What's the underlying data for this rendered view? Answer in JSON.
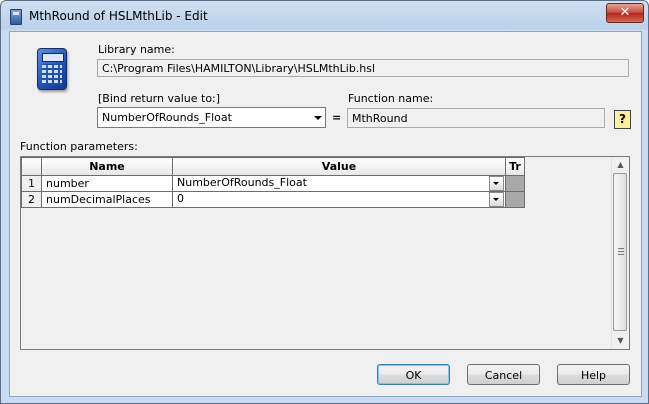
{
  "window": {
    "title": "MthRound of HSLMthLib - Edit",
    "close_glyph": "✕"
  },
  "library": {
    "label": "Library name:",
    "value": "C:\\Program Files\\HAMILTON\\Library\\HSLMthLib.hsl"
  },
  "bind_return": {
    "label": "[Bind return value to:]",
    "value": "NumberOfRounds_Float"
  },
  "equals": "=",
  "function": {
    "label": "Function name:",
    "value": "MthRound",
    "help_glyph": "?"
  },
  "parameters": {
    "label": "Function parameters:",
    "columns": {
      "name": "Name",
      "value": "Value",
      "tr": "Tr"
    },
    "rows": [
      {
        "index": "1",
        "name": "number",
        "value": "NumberOfRounds_Float"
      },
      {
        "index": "2",
        "name": "numDecimalPlaces",
        "value": "0"
      }
    ]
  },
  "buttons": {
    "ok": "OK",
    "cancel": "Cancel",
    "help": "Help"
  },
  "icons": {
    "app": "dialog-app-icon",
    "calculator": "calculator-icon",
    "help": "help-icon",
    "close": "close-icon"
  },
  "colors": {
    "titlebar": "#b9d1ea",
    "client": "#f0f0f0",
    "help_button": "#ffef9b",
    "close_button": "#c9473a"
  }
}
